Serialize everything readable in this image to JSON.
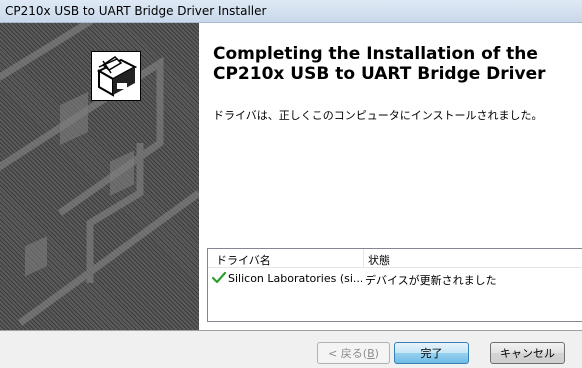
{
  "window": {
    "title": "CP210x USB to UART Bridge Driver Installer"
  },
  "main": {
    "heading": "Completing the Installation of the CP210x USB to UART Bridge Driver",
    "description": "ドライバは、正しくこのコンピュータにインストールされました。"
  },
  "listview": {
    "columns": [
      "ドライバ名",
      "状態"
    ],
    "rows": [
      {
        "name": "Silicon Laboratories (si...",
        "status": "デバイスが更新されました",
        "status_icon": "green-checkmark-icon"
      }
    ]
  },
  "buttons": {
    "back_label": "< 戻る(",
    "back_accel": "B",
    "back_suffix": ")",
    "finish_label": "完了",
    "cancel_label": "キャンセル"
  },
  "colors": {
    "check_green": "#2f9e2f",
    "default_button_border": "#3c7fb1"
  }
}
